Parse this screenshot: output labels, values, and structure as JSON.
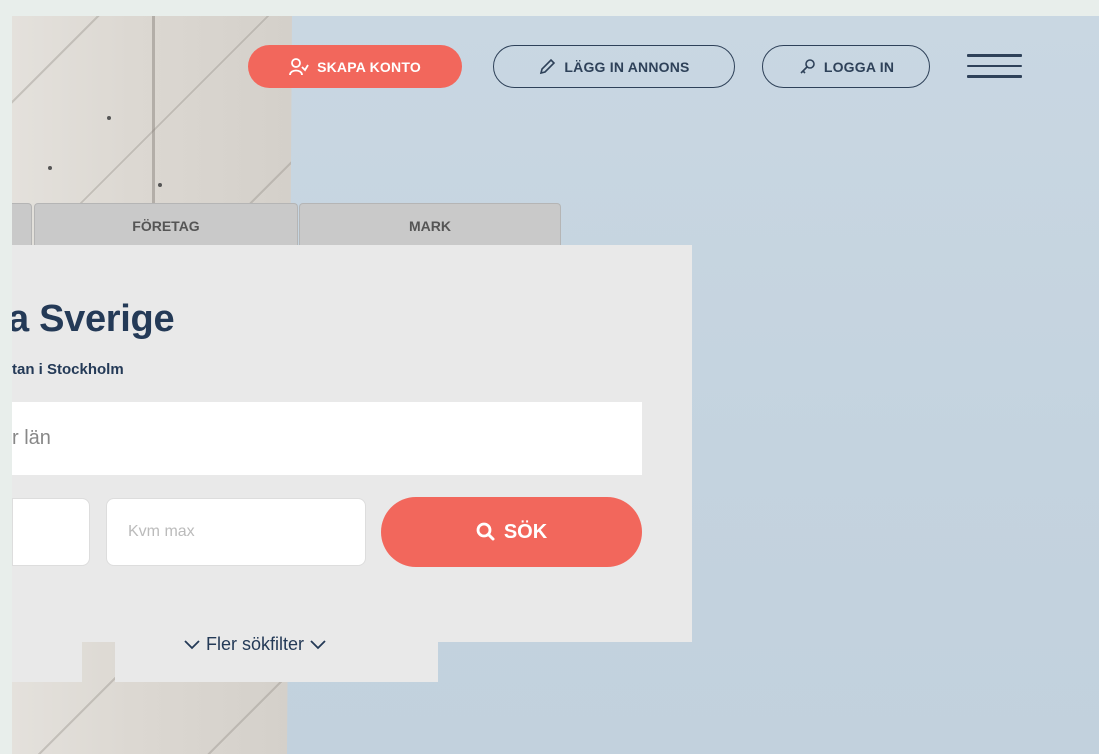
{
  "header": {
    "create_account": "SKAPA KONTO",
    "post_ad": "LÄGG IN ANNONS",
    "login": "LOGGA IN"
  },
  "tabs": [
    {
      "label": ""
    },
    {
      "label": "FÖRETAG"
    },
    {
      "label": "MARK"
    }
  ],
  "search": {
    "title": "a Sverige",
    "subtitle": "tan i Stockholm",
    "location_placeholder": "r län",
    "sqm_max_placeholder": "Kvm max",
    "search_button": "SÖK",
    "more_filters": "Fler sökfilter"
  },
  "colors": {
    "accent": "#f2675c",
    "navy": "#243a57",
    "sky": "#c6d5e0"
  }
}
